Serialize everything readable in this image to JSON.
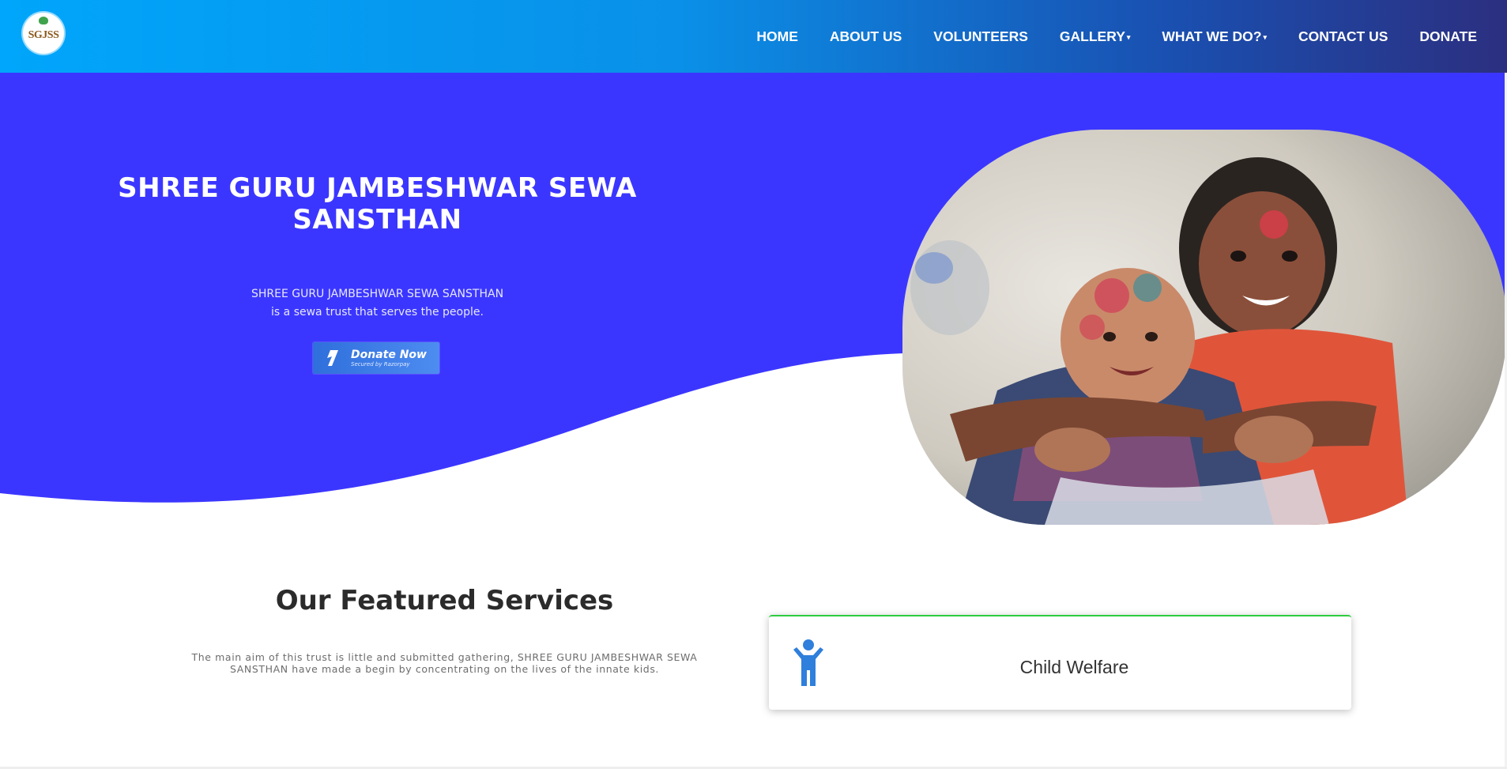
{
  "brand": {
    "logo_text": "SGJSS"
  },
  "nav": {
    "items": [
      {
        "label": "HOME",
        "dropdown": false
      },
      {
        "label": "ABOUT US",
        "dropdown": false
      },
      {
        "label": "VOLUNTEERS",
        "dropdown": false
      },
      {
        "label": "GALLERY",
        "dropdown": true
      },
      {
        "label": "WHAT WE DO?",
        "dropdown": true
      },
      {
        "label": "CONTACT US",
        "dropdown": false
      },
      {
        "label": "DONATE",
        "dropdown": false
      }
    ]
  },
  "hero": {
    "title": "SHREE GURU JAMBESHWAR SEWA SANSTHAN",
    "subtitle_line1": "SHREE GURU JAMBESHWAR SEWA SANSTHAN",
    "subtitle_line2": "is a sewa trust that serves the people.",
    "donate_button": {
      "label": "Donate Now",
      "sublabel": "Secured by Razorpay",
      "icon": "razorpay-icon"
    }
  },
  "featured": {
    "title": "Our Featured Services",
    "description": "The main aim of this trust is little and submitted gathering, SHREE GURU JAMBESHWAR SEWA SANSTHAN have made a begin by concentrating on the lives of the innate kids.",
    "services": [
      {
        "label": "Child Welfare",
        "icon": "child-icon"
      }
    ]
  },
  "colors": {
    "nav_gradient_start": "#00a6fb",
    "nav_gradient_end": "#2c2f80",
    "hero_blue": "#3b36ff",
    "card_accent": "#2ecc40",
    "icon_blue": "#2f7fdc"
  }
}
